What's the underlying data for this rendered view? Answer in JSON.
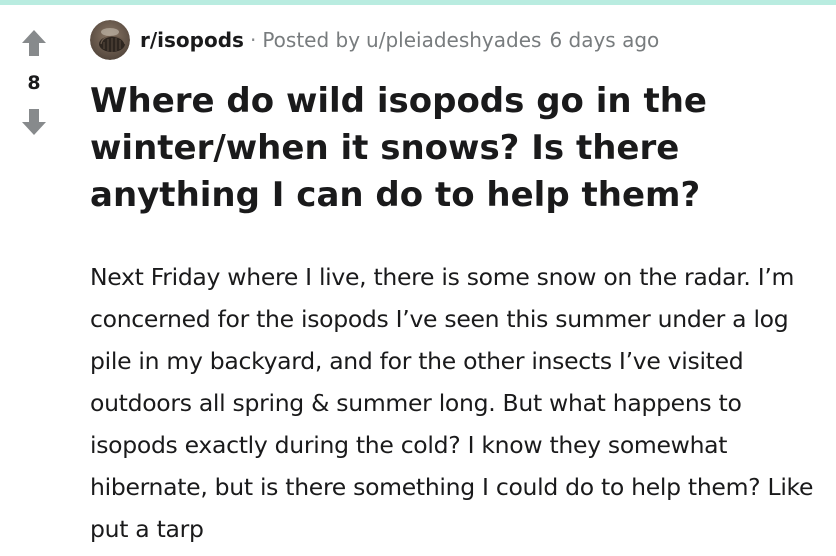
{
  "post": {
    "subreddit": "r/isopods",
    "separator": "·",
    "posted_by_label": "Posted by",
    "author": "u/pleiadeshyades",
    "time_ago": "6 days ago",
    "vote_count": "8",
    "title": "Where do wild isopods go in the winter/when it snows? Is there anything I can do to help them?",
    "body": "Next Friday where I live, there is some snow on the radar. I’m concerned for the isopods I’ve seen this summer under a log pile in my backyard, and for the other insects I’ve visited outdoors all spring & summer long. But what happens to isopods exactly during the cold? I know they somewhat hibernate, but is there something I could do to help them? Like put a tarp"
  },
  "icons": {
    "upvote": "upvote-arrow-icon",
    "downvote": "downvote-arrow-icon",
    "avatar": "subreddit-avatar"
  },
  "colors": {
    "top_bar": "#b9ece0",
    "vote_arrow": "#878a8c",
    "meta_text": "#787c7e",
    "text": "#1a1a1b"
  }
}
